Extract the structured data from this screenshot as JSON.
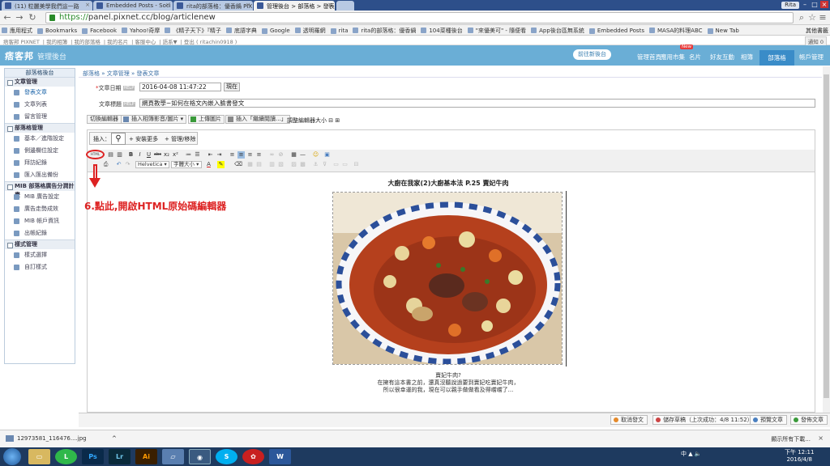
{
  "browser": {
    "tabs": [
      {
        "label": "(11) 粒麗美學我們這一路"
      },
      {
        "label": "Embedded Posts - Soci"
      },
      {
        "label": "rita的部落格：優香鍋 PIX"
      },
      {
        "label": "管理後台 > 部落格 > 發表"
      }
    ],
    "user": "Rita",
    "url_scheme": "https://",
    "url_rest": "panel.pixnet.cc/blog/articlenew",
    "bookmarks": [
      "應用程式",
      "Bookmarks",
      "Facebook",
      "Yahoo!奇摩",
      "《精子天下》『精子",
      "底語字典",
      "Google",
      "透明羅網",
      "rita",
      "rita的部落格：優香鍋",
      "104菜種後台",
      "\"來優美可\" - 隨便看",
      "App後台區無系統",
      "Embedded Posts",
      "MASA的料理ABC",
      "New Tab"
    ],
    "bookmarks_other": "其他書籤"
  },
  "pixnet_topstrip": [
    "痞客邦 PIXNET",
    "我的相簿",
    "我的部落格",
    "我的名片",
    "客服中心",
    "語系▼",
    "登出 ( ritachin0918 )"
  ],
  "notify": "通知 0",
  "header": {
    "logo": "痞客邦",
    "subtitle": "管理後台",
    "goto_new": "前往新後台",
    "nav": [
      "管理首頁",
      "應用市集",
      "名片",
      "好友互動",
      "相簿",
      "部落格",
      "帳戶管理"
    ],
    "active": "部落格",
    "new_badge": "New"
  },
  "sidebar": {
    "title": "部落格後台",
    "groups": [
      {
        "label": "文章管理",
        "items": [
          "發表文章",
          "文章列表",
          "留言管理"
        ]
      },
      {
        "label": "部落格管理",
        "items": [
          "基本／進階設定",
          "側邊欄位設定",
          "拜訪紀錄",
          "匯入匯出備份"
        ]
      },
      {
        "label": "MIB 部落格廣告分潤計畫",
        "items": [
          "MIB 廣告設定",
          "廣告走勢成效",
          "MIB 帳戶資訊",
          "出帳紀錄"
        ]
      },
      {
        "label": "樣式管理",
        "items": [
          "樣式選擇",
          "自訂樣式"
        ]
      }
    ]
  },
  "breadcrumb": [
    "部落格",
    "文章管理",
    "發表文章"
  ],
  "form": {
    "date_label": "文章日期",
    "date_value": "2016-04-08 11:47:22",
    "now_label": "現在",
    "title_label": "文章標題",
    "title_value": "網頁教學~如何在格文內嵌入臉書發文",
    "help": "HELP"
  },
  "editor_tools": [
    "切換編輯器",
    "插入相簿影音/圖片 ▾",
    "上傳圖片",
    "插入「繼續閱讀...」",
    "調整編輯器大小"
  ],
  "insert_bar": {
    "label": "插入：",
    "install_more": "安裝更多",
    "manage": "管理/移除"
  },
  "toolbar": {
    "font": "Helvetica",
    "size": "字體大小",
    "html_label": "HTML"
  },
  "annotation": "6.點此,開啟HTML原始碼編輯器",
  "post": {
    "heading": "大廚在我家(2)大廚基本法 P.25 賣妃牛肉",
    "caption": [
      "賣妃牛肉?",
      "在擁有這本書之前，還真沒聽說過要到賣妃吃賣妃牛肉，",
      "所以很幸運的我，現在可以親手做做看及得嚐嚐了..."
    ]
  },
  "actions": {
    "cancel": "取消發文",
    "save": "儲存草稿（上次成功：4/8 11:52）",
    "preview": "預覽文章",
    "publish": "發佈文章"
  },
  "downloads": {
    "file": "12973581_116476....jpg",
    "show_all": "顯示所有下載...",
    "close": "×"
  },
  "taskbar": {
    "tray": "中 ▲ 🔈",
    "time": "下午 12:11",
    "date": "2016/4/8"
  },
  "colors": {
    "header": "#6aaed6",
    "annotation": "#dd2222",
    "taskbar": "#1e3a5f"
  }
}
